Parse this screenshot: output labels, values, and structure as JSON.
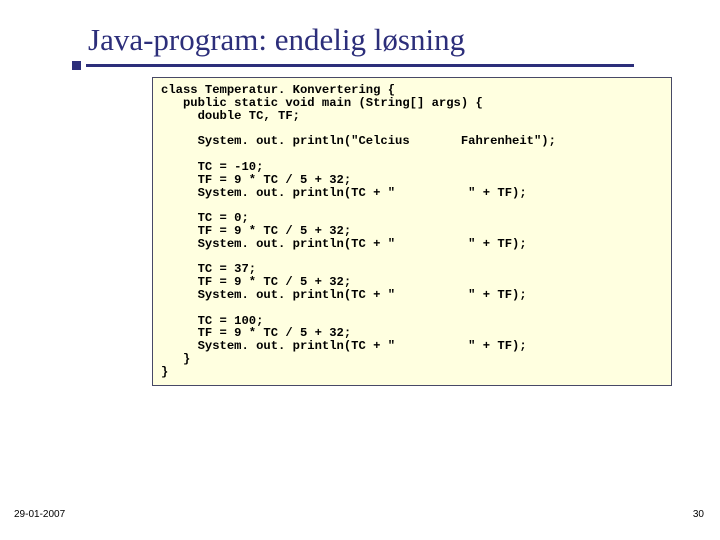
{
  "title": "Java-program: endelig løsning",
  "code": "class Temperatur. Konvertering {\n   public static void main (String[] args) {\n     double TC, TF;\n\n     System. out. println(\"Celcius       Fahrenheit\");\n\n     TC = -10;\n     TF = 9 * TC / 5 + 32;\n     System. out. println(TC + \"          \" + TF);\n\n     TC = 0;\n     TF = 9 * TC / 5 + 32;\n     System. out. println(TC + \"          \" + TF);\n\n     TC = 37;\n     TF = 9 * TC / 5 + 32;\n     System. out. println(TC + \"          \" + TF);\n\n     TC = 100;\n     TF = 9 * TC / 5 + 32;\n     System. out. println(TC + \"          \" + TF);\n   }\n}",
  "footer": {
    "date": "29-01-2007",
    "page": "30"
  }
}
